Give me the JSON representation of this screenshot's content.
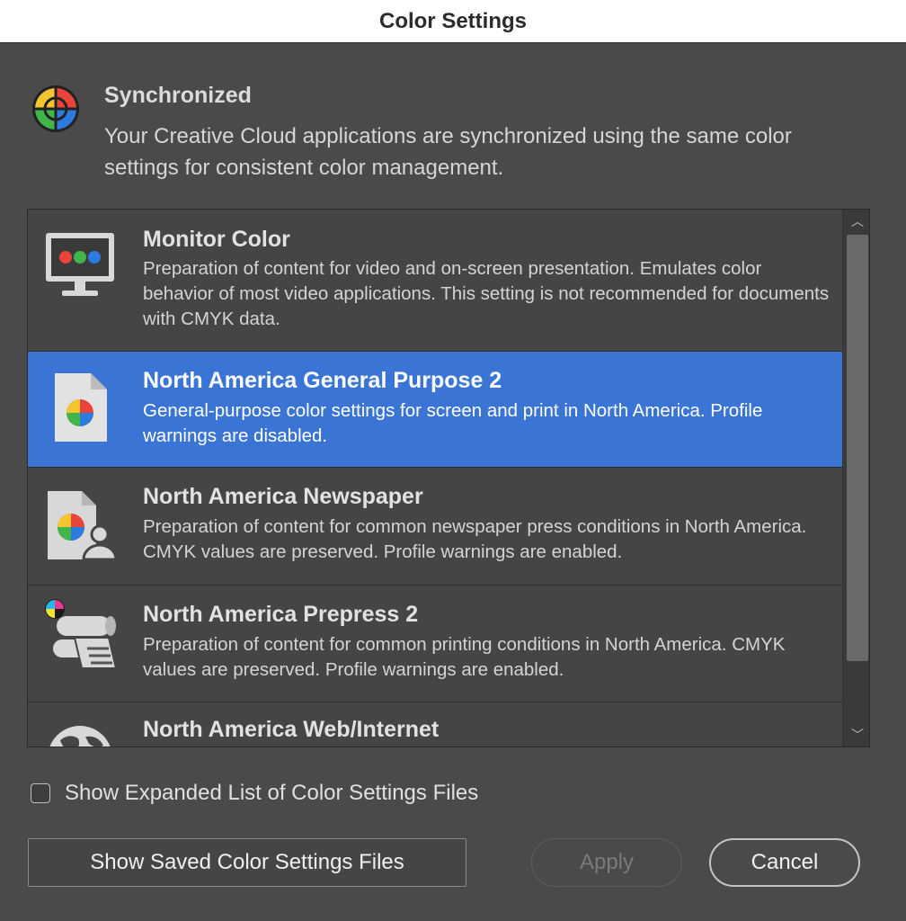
{
  "window": {
    "title": "Color Settings"
  },
  "sync": {
    "title": "Synchronized",
    "description": "Your Creative Cloud applications are synchronized using the same color settings for consistent color management."
  },
  "list": {
    "items": [
      {
        "name": "Monitor Color",
        "description": "Preparation of content for video and on-screen presentation. Emulates color behavior of most video applications. This setting is not recommended for documents with CMYK data.",
        "icon": "monitor-icon",
        "selected": false
      },
      {
        "name": "North America General Purpose 2",
        "description": "General-purpose color settings for screen and print in North America. Profile warnings are disabled.",
        "icon": "document-color-icon",
        "selected": true
      },
      {
        "name": "North America Newspaper",
        "description": "Preparation of content for common newspaper press conditions in North America. CMYK values are preserved. Profile warnings are enabled.",
        "icon": "newspaper-icon",
        "selected": false
      },
      {
        "name": "North America Prepress 2",
        "description": "Preparation of content for common printing conditions in North America. CMYK values are preserved. Profile warnings are enabled.",
        "icon": "printing-press-icon",
        "selected": false
      },
      {
        "name": "North America Web/Internet",
        "description": "",
        "icon": "globe-icon",
        "selected": false
      }
    ],
    "scroll_up_glyph": "︿",
    "scroll_down_glyph": "﹀"
  },
  "options": {
    "expanded_list_label": "Show Expanded List of Color Settings Files",
    "expanded_list_checked": false
  },
  "buttons": {
    "saved_files": "Show Saved Color Settings Files",
    "apply": "Apply",
    "cancel": "Cancel"
  },
  "colors": {
    "selection": "#3a75d6",
    "background": "#4a4a4a"
  }
}
